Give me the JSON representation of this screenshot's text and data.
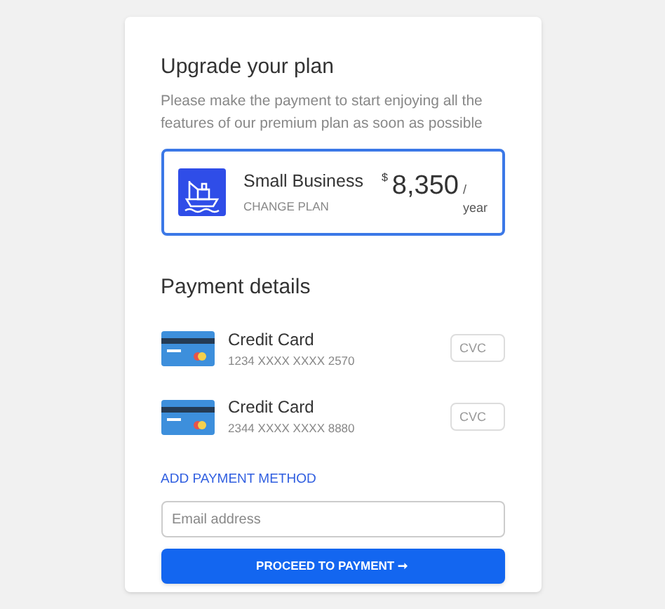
{
  "title": "Upgrade your plan",
  "description": "Please make the payment to start enjoying all the features of our premium plan as soon as possible",
  "plan": {
    "name": "Small Business",
    "action": "CHANGE PLAN",
    "currency": "$",
    "price": "8,350",
    "period": "/ year",
    "selected": true
  },
  "payment": {
    "title": "Payment details",
    "cards": [
      {
        "name": "Credit Card",
        "number": "1234 XXXX XXXX 2570",
        "cvc_placeholder": "CVC"
      },
      {
        "name": "Credit Card",
        "number": "2344 XXXX XXXX 8880",
        "cvc_placeholder": "CVC"
      }
    ],
    "add_link": "ADD PAYMENT METHOD",
    "email_placeholder": "Email address",
    "submit": "PROCEED TO PAYMENT ➞"
  }
}
